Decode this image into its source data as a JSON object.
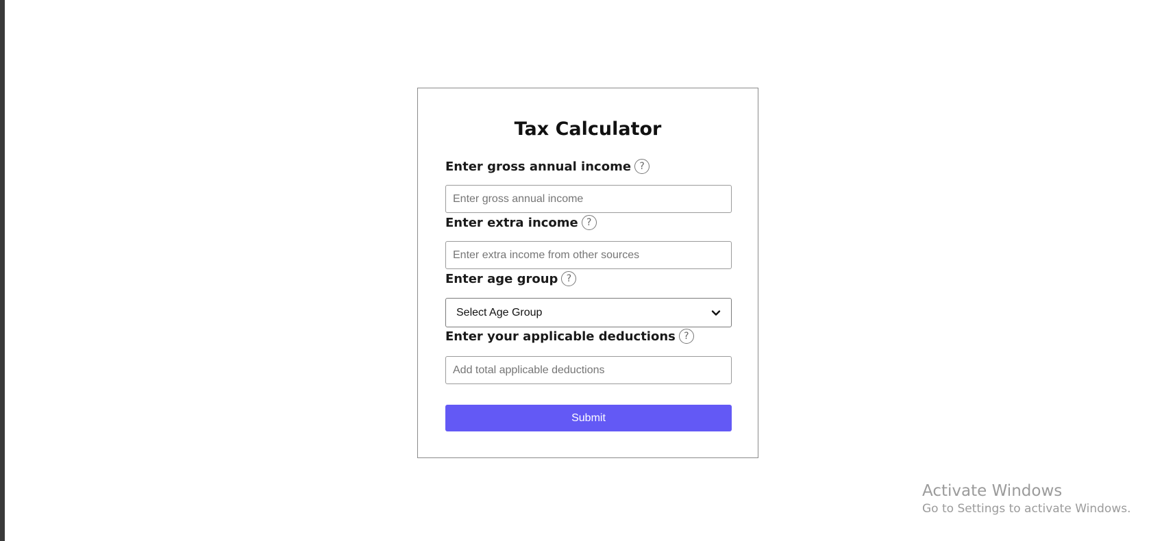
{
  "form": {
    "title": "Tax Calculator",
    "fields": [
      {
        "label": "Enter gross annual income",
        "placeholder": "Enter gross annual income",
        "value": ""
      },
      {
        "label": "Enter extra income",
        "placeholder": "Enter extra income from other sources",
        "value": ""
      },
      {
        "label": "Enter age group",
        "selected": "Select Age Group"
      },
      {
        "label": "Enter your applicable deductions",
        "placeholder": "Add total applicable deductions",
        "value": ""
      }
    ],
    "help_glyph": "?",
    "submit_label": "Submit"
  },
  "watermark": {
    "title": "Activate Windows",
    "subtitle": "Go to Settings to activate Windows."
  },
  "colors": {
    "button": "#6359f5",
    "button_text": "#ffffff",
    "card_border": "#8a8a8a",
    "watermark_text": "#9b9b9b"
  },
  "icons": {
    "help": "question-mark-circle-icon",
    "select_arrow": "chevron-down-icon"
  }
}
